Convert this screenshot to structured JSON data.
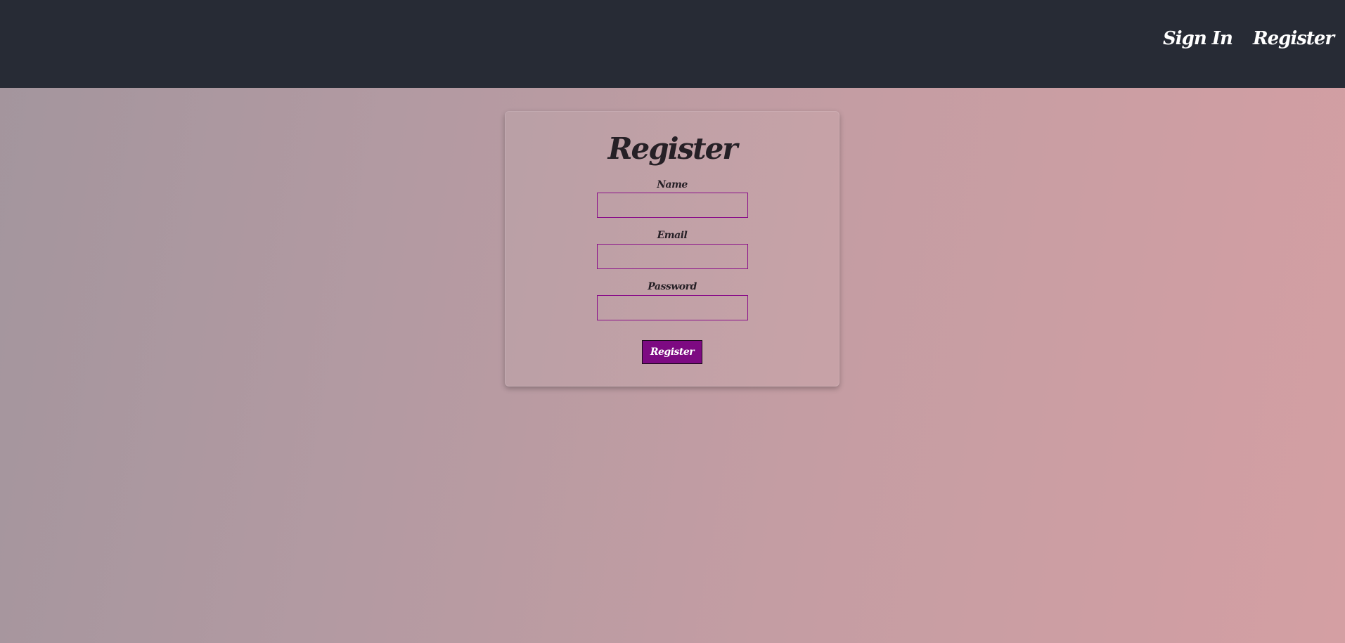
{
  "nav": {
    "sign_in_label": "Sign In",
    "register_label": "Register"
  },
  "form": {
    "title": "Register",
    "fields": [
      {
        "label": "Name",
        "value": "",
        "placeholder": ""
      },
      {
        "label": "Email",
        "value": "",
        "placeholder": ""
      },
      {
        "label": "Password",
        "value": "",
        "placeholder": ""
      }
    ],
    "submit_label": "Register"
  },
  "colors": {
    "navbar": "#272b35",
    "accent": "#7d0a82",
    "input_border": "#8a0f8a",
    "text_dark": "#262026",
    "nav_text": "#ffffff"
  }
}
